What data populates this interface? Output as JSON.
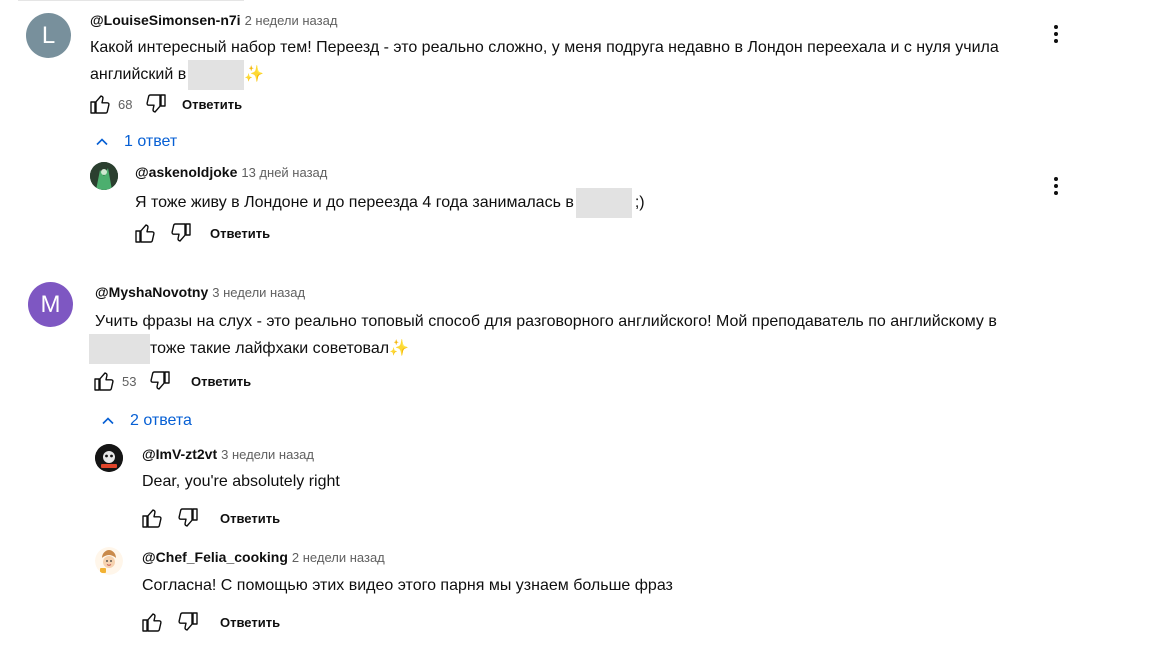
{
  "comments": [
    {
      "author": "@LouiseSimonsen-n7i",
      "time": "2 недели назад",
      "avatar_letter": "L",
      "avatar_color": "#78909c",
      "line1": "Какой интересный набор тем! Переезд - это реально сложно, у меня подруга недавно в Лондон переехала и с нуля учила",
      "line2_before": "английский в",
      "line2_after": "✨",
      "likes": "68",
      "reply_label": "Ответить",
      "replies_toggle": "1 ответ",
      "replies": [
        {
          "author": "@askenoldjoke",
          "time": "13 дней назад",
          "text_before": "Я тоже живу в Лондоне и до переезда 4 года занималась в",
          "text_after": ";)",
          "reply_label": "Ответить"
        }
      ]
    },
    {
      "author": "@MyshaNovotny",
      "time": "3 недели назад",
      "avatar_letter": "M",
      "avatar_color": "#7e57c2",
      "line1": "Учить фразы на слух - это реально топовый способ для разговорного английского! Мой преподаватель по английскому в",
      "line2_after": "тоже такие лайфхаки советовал✨",
      "likes": "53",
      "reply_label": "Ответить",
      "replies_toggle": "2 ответа",
      "replies": [
        {
          "author": "@ImV-zt2vt",
          "time": "3 недели назад",
          "text": "Dear, you're absolutely right",
          "reply_label": "Ответить"
        },
        {
          "author": "@Chef_Felia_cooking",
          "time": "2 недели назад",
          "text": "Согласна! С помощью этих видео этого парня мы узнаем больше фраз",
          "reply_label": "Ответить"
        }
      ]
    }
  ],
  "colors": {
    "link_blue": "#065fd4",
    "secondary_text": "#606060",
    "redaction": "#e2e2e2"
  },
  "icons": [
    "like-icon",
    "dislike-icon",
    "chevron-up-icon",
    "more-vert-icon"
  ]
}
